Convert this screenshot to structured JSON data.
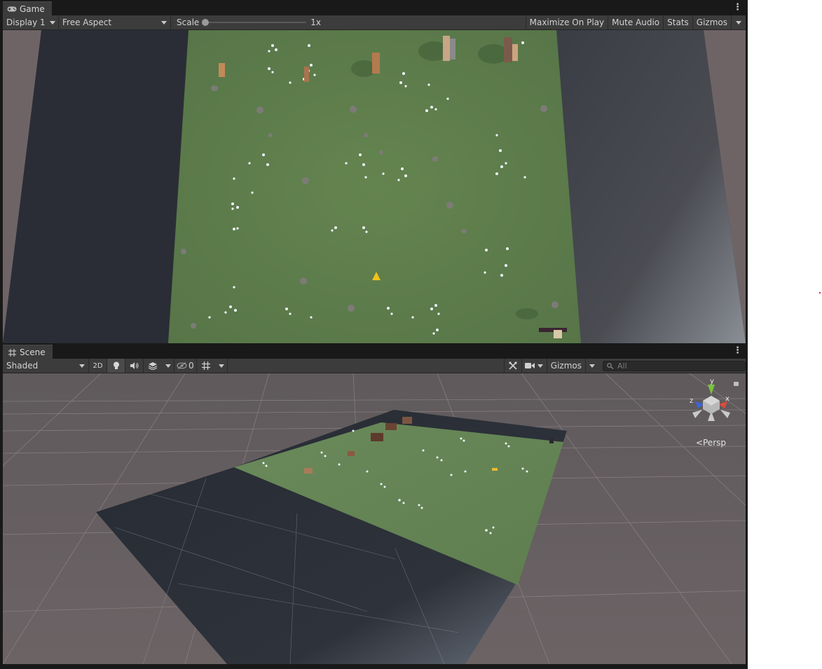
{
  "game": {
    "tab_label": "Game",
    "display": "Display 1",
    "aspect": "Free Aspect",
    "scale_label": "Scale",
    "scale_value": "1x",
    "scale_fraction": 0.0,
    "maximize_on_play": "Maximize On Play",
    "mute_audio": "Mute Audio",
    "stats": "Stats",
    "gizmos": "Gizmos"
  },
  "scene": {
    "tab_label": "Scene",
    "draw_mode": "Shaded",
    "mode_2d": "2D",
    "hidden_count": "0",
    "gizmos": "Gizmos",
    "search_placeholder": "All",
    "projection": "Persp",
    "axis_x": "x",
    "axis_y": "y",
    "axis_z": "z"
  },
  "colors": {
    "editor_bg": "#191919",
    "toolbar_bg": "#3c3c3c",
    "grass": "#5e7e4f",
    "ground_gray": "#6d6466",
    "dark_plane": "#2b3038",
    "flower": "#e8f2ff",
    "rock": "#7a7a7a"
  },
  "icons": [
    "gamepad-icon",
    "grid-icon",
    "kebab-menu-icon",
    "bulb-icon",
    "speaker-icon",
    "layers-icon",
    "eye-slash-icon",
    "grid-snap-icon",
    "tools-icon",
    "camera-icon",
    "search-icon",
    "lock-icon"
  ]
}
